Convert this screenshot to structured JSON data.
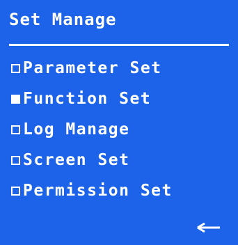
{
  "header": {
    "title": "Set Manage"
  },
  "menu": {
    "items": [
      {
        "label": "Parameter Set",
        "selected": false
      },
      {
        "label": "Function Set",
        "selected": true
      },
      {
        "label": "Log Manage",
        "selected": false
      },
      {
        "label": "Screen Set",
        "selected": false
      },
      {
        "label": "Permission Set",
        "selected": false
      }
    ]
  },
  "footer": {
    "back_icon": "left-arrow-icon"
  },
  "colors": {
    "background": "#1c63e9",
    "foreground": "#ffffff"
  }
}
